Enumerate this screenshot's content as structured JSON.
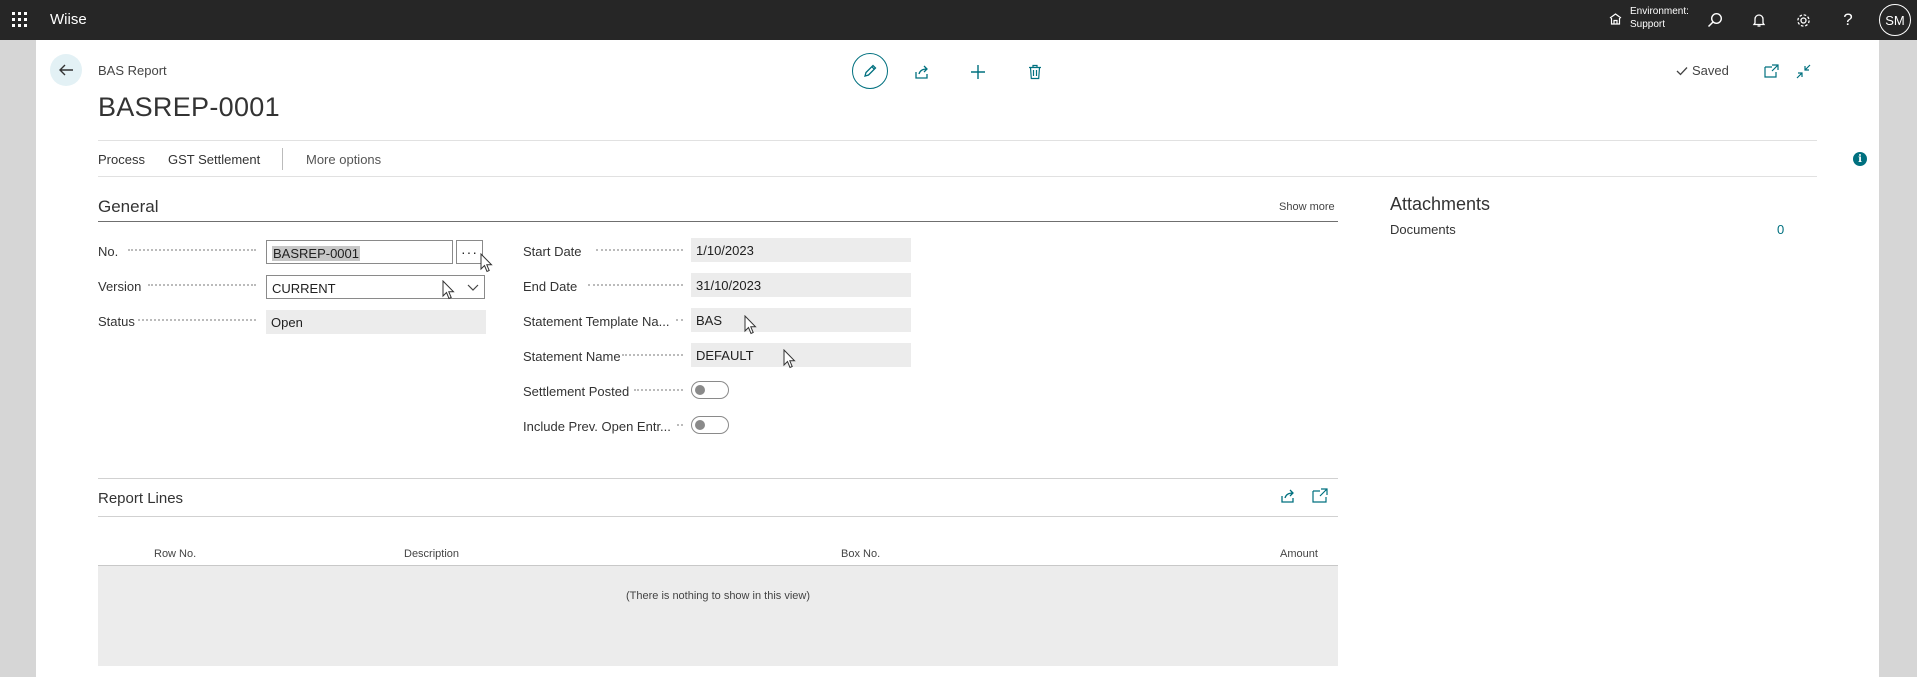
{
  "app": {
    "name": "Wiise"
  },
  "topbar": {
    "environment_label": "Environment:",
    "environment_value": "Support",
    "avatar_initials": "SM"
  },
  "page": {
    "caption": "BAS Report",
    "title": "BASREP-0001",
    "saved_label": "Saved"
  },
  "actions": {
    "process": "Process",
    "gst_settlement": "GST Settlement",
    "more_options": "More options"
  },
  "general": {
    "title": "General",
    "show_more": "Show more",
    "no_label": "No.",
    "no_value": "BASREP-0001",
    "version_label": "Version",
    "version_value": "CURRENT",
    "status_label": "Status",
    "status_value": "Open",
    "start_date_label": "Start Date",
    "start_date_value": "1/10/2023",
    "end_date_label": "End Date",
    "end_date_value": "31/10/2023",
    "template_label": "Statement Template Na...",
    "template_value": "BAS",
    "statement_name_label": "Statement Name",
    "statement_name_value": "DEFAULT",
    "settlement_posted_label": "Settlement Posted",
    "settlement_posted_value": false,
    "include_prev_label": "Include Prev. Open Entr...",
    "include_prev_value": false
  },
  "attachments": {
    "title": "Attachments",
    "documents_label": "Documents",
    "documents_count": "0"
  },
  "report_lines": {
    "title": "Report Lines",
    "columns": [
      "Row No.",
      "Description",
      "Box No.",
      "Amount"
    ],
    "empty_text": "(There is nothing to show in this view)"
  },
  "colors": {
    "accent": "#00707f",
    "topbar": "#262626"
  }
}
